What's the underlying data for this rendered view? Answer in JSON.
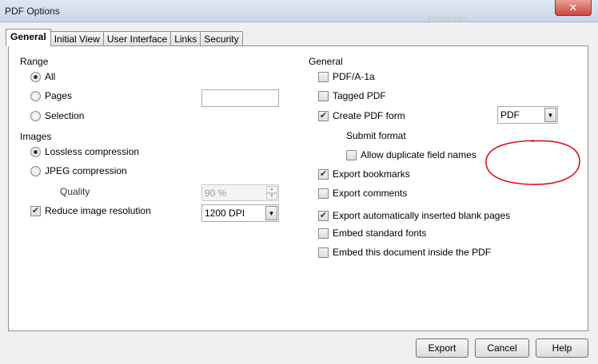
{
  "window": {
    "title": "PDF Options",
    "close_symbol": "✕"
  },
  "background_ghost_text": "Properties",
  "tabs": [
    "General",
    "Initial View",
    "User Interface",
    "Links",
    "Security"
  ],
  "range": {
    "title": "Range",
    "options": [
      "All",
      "Pages",
      "Selection"
    ],
    "selected": "All",
    "pages_value": ""
  },
  "images": {
    "title": "Images",
    "options": [
      "Lossless compression",
      "JPEG compression"
    ],
    "selected": "Lossless compression",
    "quality_label": "Quality",
    "quality_value": "90 %",
    "reduce_label": "Reduce image resolution",
    "reduce_checked": true,
    "resolution_value": "1200 DPI"
  },
  "general": {
    "title": "General",
    "pdfa": {
      "label": "PDF/A-1a",
      "checked": false
    },
    "tagged": {
      "label": "Tagged PDF",
      "checked": false
    },
    "create_form": {
      "label": "Create PDF form",
      "checked": true
    },
    "submit_format_label": "Submit format",
    "submit_format_value": "PDF",
    "allow_duplicate": {
      "label": "Allow duplicate field names",
      "checked": false
    },
    "export_bookmarks": {
      "label": "Export bookmarks",
      "checked": true
    },
    "export_comments": {
      "label": "Export comments",
      "checked": false
    },
    "export_blank": {
      "label": "Export automatically inserted blank pages",
      "checked": true
    },
    "embed_fonts": {
      "label": "Embed standard fonts",
      "checked": false
    },
    "embed_document": {
      "label": "Embed this document inside the PDF",
      "checked": false
    }
  },
  "buttons": {
    "export": "Export",
    "cancel": "Cancel",
    "help": "Help"
  },
  "icons": {
    "checkmark": "✔",
    "dropdown": "▼",
    "spin_up": "▲",
    "spin_down": "▼"
  },
  "colors": {
    "annotation": "#d8141b"
  }
}
